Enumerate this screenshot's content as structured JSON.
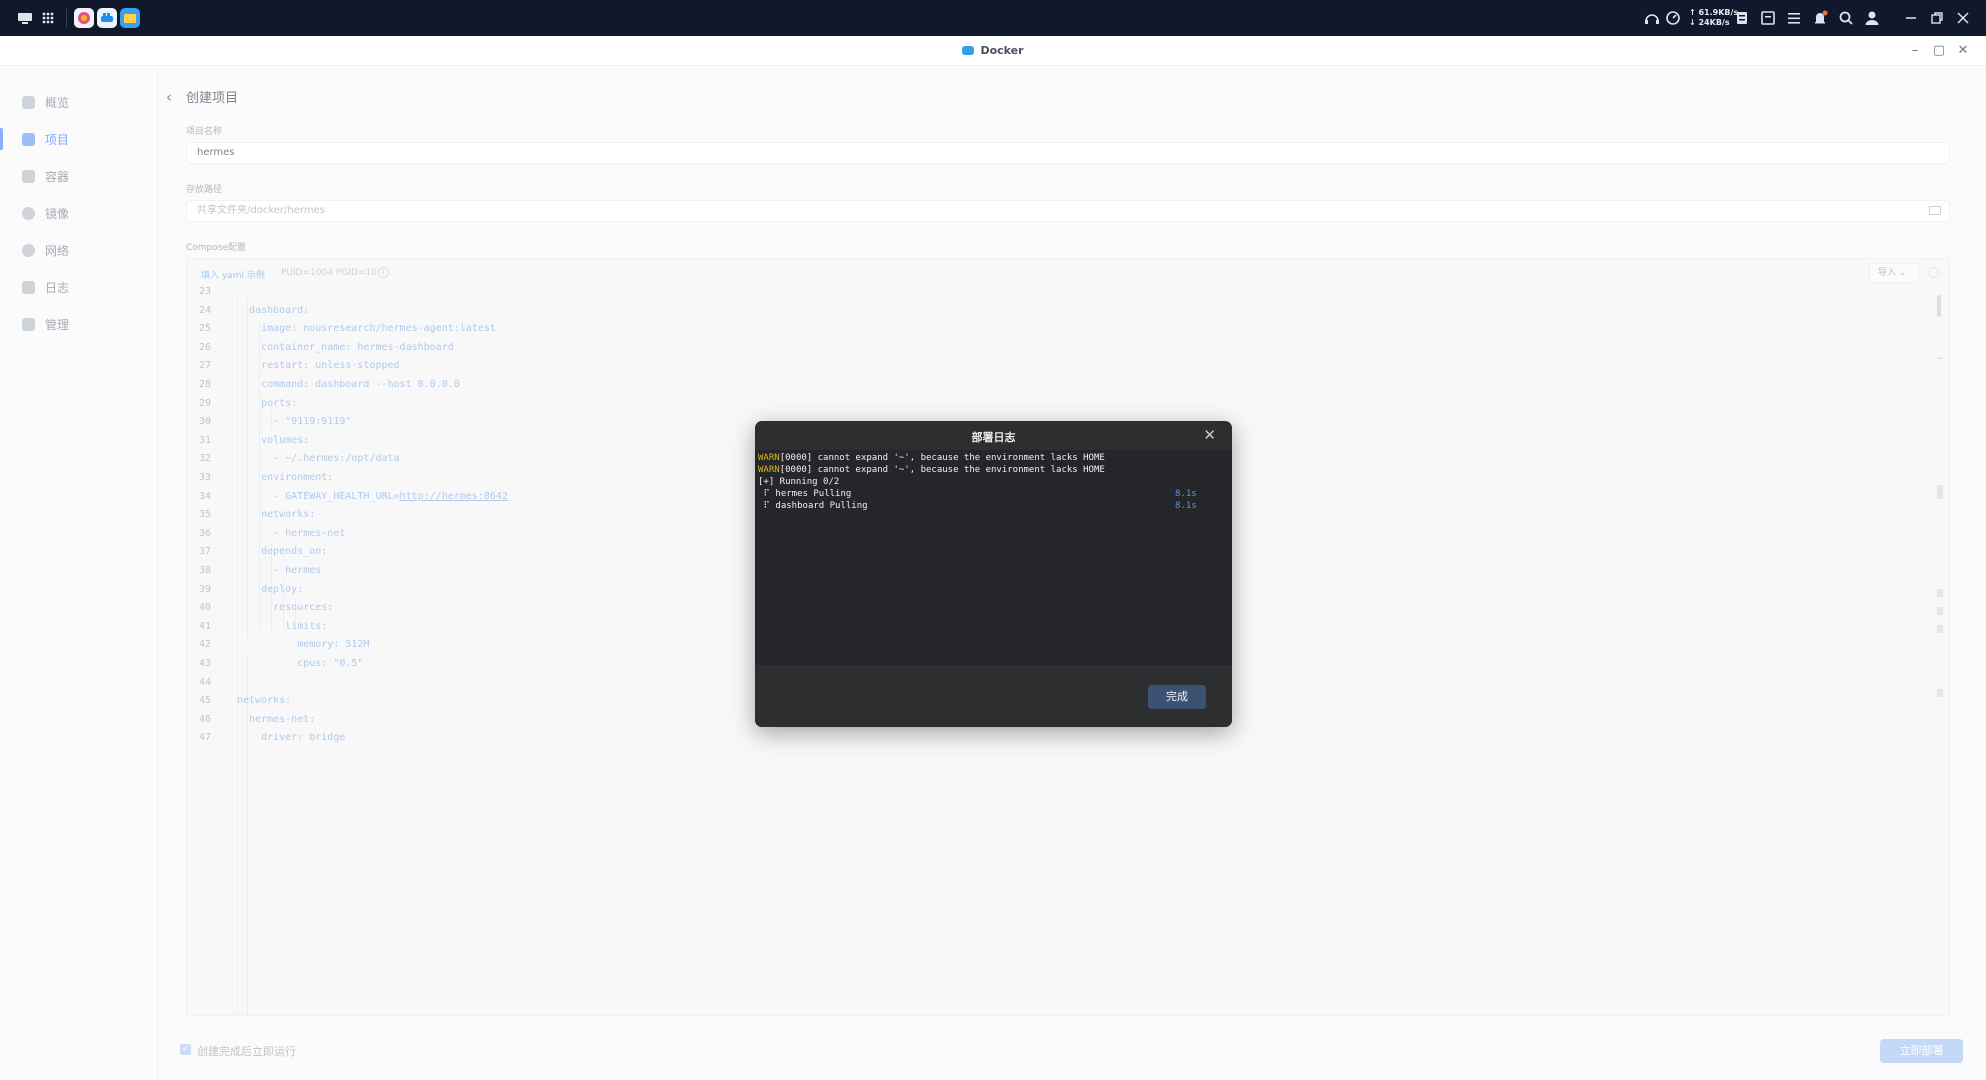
{
  "window": {
    "title": "Docker"
  },
  "sidebar": {
    "items": [
      {
        "label": "概览",
        "icon": "dashboard-icon",
        "active": false
      },
      {
        "label": "项目",
        "icon": "project-icon",
        "active": true
      },
      {
        "label": "容器",
        "icon": "container-icon",
        "active": false
      },
      {
        "label": "镜像",
        "icon": "image-icon",
        "active": false
      },
      {
        "label": "网络",
        "icon": "network-icon",
        "active": false
      },
      {
        "label": "日志",
        "icon": "log-icon",
        "active": false
      },
      {
        "label": "管理",
        "icon": "manage-icon",
        "active": false
      }
    ]
  },
  "page": {
    "title": "创建项目",
    "name_label": "项目名称",
    "name_value": "hermes",
    "path_label": "存放路径",
    "path_value": "共享文件夹/docker/hermes",
    "compose_label": "Compose配置",
    "compose_example_link": "填入 yaml 示例",
    "compose_env": "PUID=1004 PGID=10",
    "import_label": "导入",
    "autorun_label": "创建完成后立即运行",
    "autorun_checked": true,
    "deploy_button": "立即部署"
  },
  "topbar": {
    "net_up": "↑ 61.9KB/s",
    "net_down": "↓ 24KB/s",
    "colors": {
      "bg": "#12182c"
    }
  },
  "code_lines": [
    {
      "n": "23",
      "text": ""
    },
    {
      "n": "24",
      "text": "  dashboard:"
    },
    {
      "n": "25",
      "text": "    image: nousresearch/hermes-agent:latest"
    },
    {
      "n": "26",
      "text": "    container_name: hermes-dashboard"
    },
    {
      "n": "27",
      "text": "    restart: unless-stopped"
    },
    {
      "n": "28",
      "text": "    command: dashboard --host 0.0.0.0"
    },
    {
      "n": "29",
      "text": "    ports:"
    },
    {
      "n": "30",
      "text": "      - \"9119:9119\""
    },
    {
      "n": "31",
      "text": "    volumes:"
    },
    {
      "n": "32",
      "text": "      - ~/.hermes:/opt/data"
    },
    {
      "n": "33",
      "text": "    environment:"
    },
    {
      "n": "34",
      "text": "      - GATEWAY_HEALTH_URL=",
      "link": "http://hermes:8642"
    },
    {
      "n": "35",
      "text": "    networks:"
    },
    {
      "n": "36",
      "text": "      - hermes-net"
    },
    {
      "n": "37",
      "text": "    depends_on:"
    },
    {
      "n": "38",
      "text": "      - hermes"
    },
    {
      "n": "39",
      "text": "    deploy:"
    },
    {
      "n": "40",
      "text": "      resources:"
    },
    {
      "n": "41",
      "text": "        limits:"
    },
    {
      "n": "42",
      "text": "          memory: 512M"
    },
    {
      "n": "43",
      "text": "          cpus: \"0.5\""
    },
    {
      "n": "44",
      "text": ""
    },
    {
      "n": "45",
      "text": "networks:"
    },
    {
      "n": "46",
      "text": "  hermes-net:"
    },
    {
      "n": "47",
      "text": "    driver: bridge"
    }
  ],
  "modal": {
    "title": "部署日志",
    "done_button": "完成",
    "log": [
      {
        "prefix": "WARN",
        "text": "[0000] cannot expand '~', because the environment lacks HOME",
        "time": ""
      },
      {
        "prefix": "WARN",
        "text": "[0000] cannot expand '~', because the environment lacks HOME",
        "time": ""
      },
      {
        "prefix": "",
        "text": "[+] Running 0/2",
        "time": ""
      },
      {
        "prefix": "",
        "text": " ⠏ hermes Pulling",
        "time": "8.1s"
      },
      {
        "prefix": "",
        "text": " ⠏ dashboard Pulling",
        "time": "8.1s"
      }
    ],
    "colors": {
      "bg": "#2d2e30",
      "log_bg": "#252629",
      "warn": "#e3b219",
      "time": "#5c94d6"
    }
  }
}
